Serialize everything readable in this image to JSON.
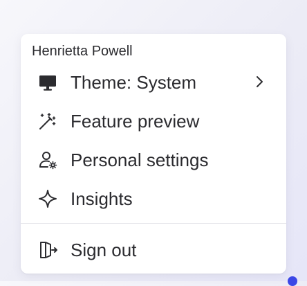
{
  "menu": {
    "user_name": "Henrietta Powell",
    "items": [
      {
        "label": "Theme: System",
        "icon": "monitor-icon",
        "has_submenu": true
      },
      {
        "label": "Feature preview",
        "icon": "magic-wand-icon"
      },
      {
        "label": "Personal settings",
        "icon": "user-settings-icon"
      },
      {
        "label": "Insights",
        "icon": "sparkle-icon"
      },
      {
        "label": "Sign out",
        "icon": "sign-out-icon"
      }
    ]
  },
  "colors": {
    "text": "#2b2b2f",
    "divider": "#e3e3e8",
    "accent": "#3b47e6"
  }
}
